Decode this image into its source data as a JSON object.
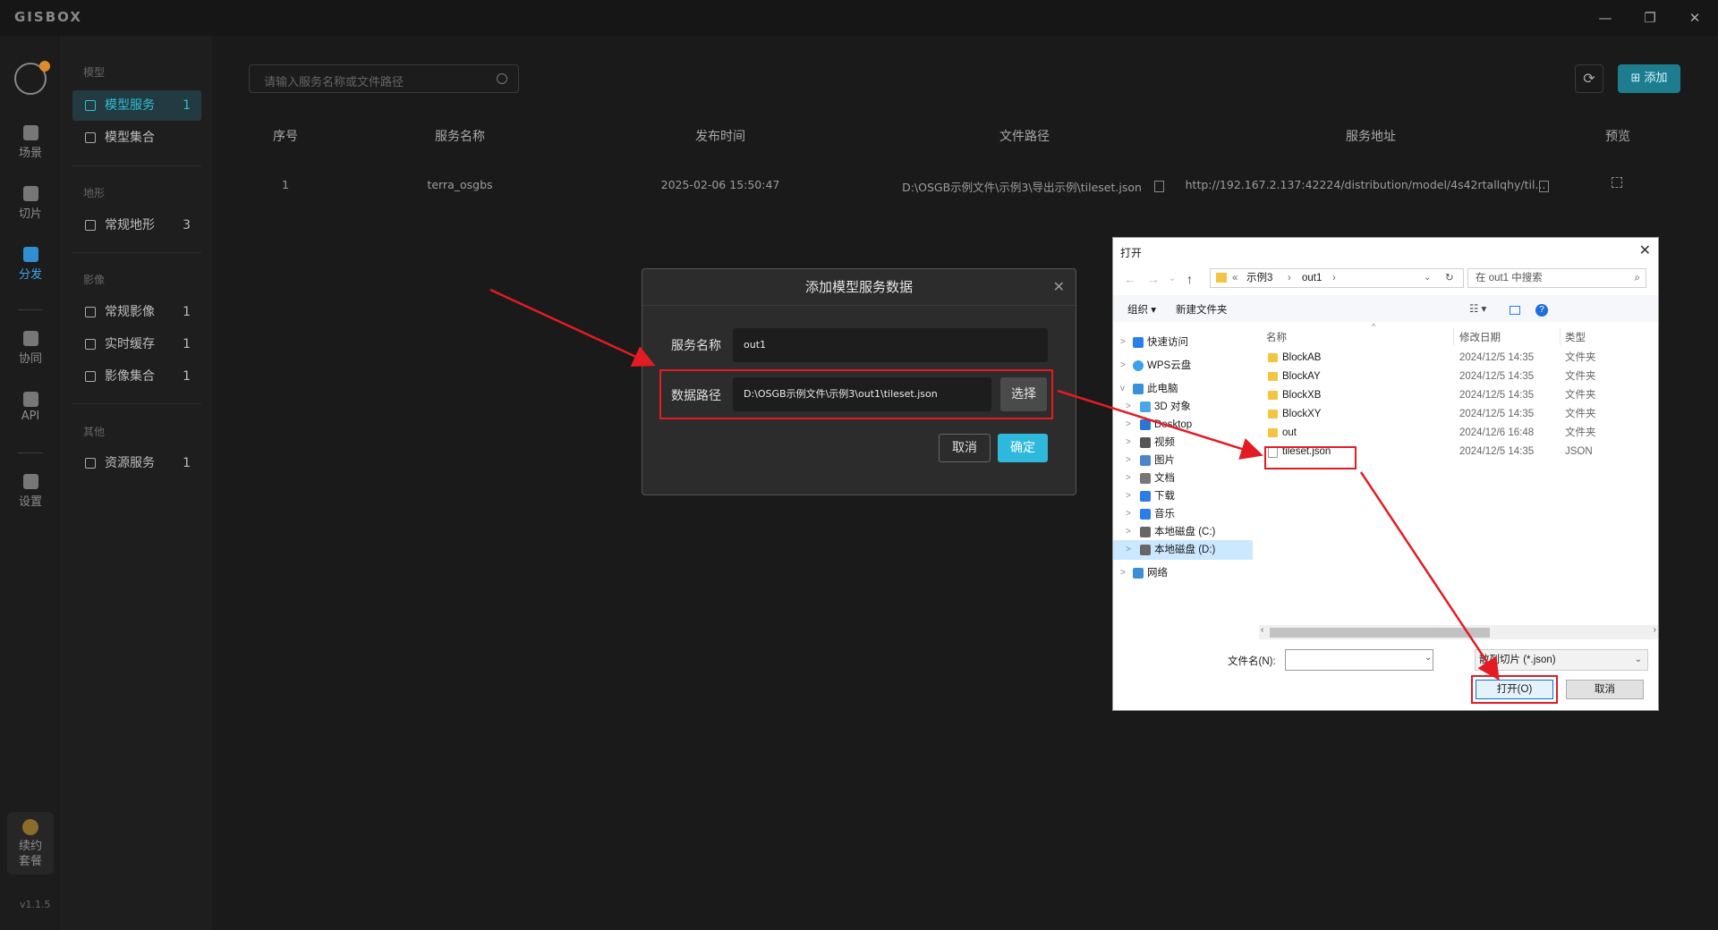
{
  "app": {
    "logo": "GISBOX",
    "version": "v1.1.5"
  },
  "window_controls": {
    "minimize": "—",
    "maximize": "❐",
    "close": "✕"
  },
  "rail": {
    "items": [
      {
        "label": "场景",
        "icon": "scene-icon"
      },
      {
        "label": "切片",
        "icon": "slice-icon"
      },
      {
        "label": "分发",
        "icon": "distribute-icon",
        "active": true
      },
      {
        "label": "协同",
        "icon": "collab-icon"
      },
      {
        "label": "API",
        "icon": "api-icon"
      },
      {
        "label": "设置",
        "icon": "settings-icon"
      }
    ],
    "renew_label_1": "续约",
    "renew_label_2": "套餐"
  },
  "sidebar": {
    "groups": [
      {
        "title": "模型",
        "items": [
          {
            "label": "模型服务",
            "count": "1",
            "active": true
          },
          {
            "label": "模型集合",
            "count": ""
          }
        ]
      },
      {
        "title": "地形",
        "items": [
          {
            "label": "常规地形",
            "count": "3"
          }
        ]
      },
      {
        "title": "影像",
        "items": [
          {
            "label": "常规影像",
            "count": "1"
          },
          {
            "label": "实时缓存",
            "count": "1"
          },
          {
            "label": "影像集合",
            "count": "1"
          }
        ]
      },
      {
        "title": "其他",
        "items": [
          {
            "label": "资源服务",
            "count": "1"
          }
        ]
      }
    ]
  },
  "main": {
    "search_placeholder": "请输入服务名称或文件路径",
    "add_label": "添加",
    "columns": [
      "序号",
      "服务名称",
      "发布时间",
      "文件路径",
      "服务地址",
      "预览"
    ],
    "rows": [
      {
        "index": "1",
        "name": "terra_osgbs",
        "time": "2025-02-06 15:50:47",
        "path": "D:\\OSGB示例文件\\示例3\\导出示例\\tileset.json",
        "url": "http://192.167.2.137:42224/distribution/model/4s42rtallqhy/til..."
      }
    ]
  },
  "dialog": {
    "title": "添加模型服务数据",
    "name_label": "服务名称",
    "name_value": "out1",
    "path_label": "数据路径",
    "path_value": "D:\\OSGB示例文件\\示例3\\out1\\tileset.json",
    "choose_label": "选择",
    "cancel_label": "取消",
    "ok_label": "确定"
  },
  "file_dialog": {
    "title": "打开",
    "breadcrumb": [
      "«",
      "示例3",
      "›",
      "out1",
      "›"
    ],
    "search_placeholder": "在 out1 中搜索",
    "organize": "组织 ▾",
    "new_folder": "新建文件夹",
    "columns": {
      "name": "名称",
      "date": "修改日期",
      "type": "类型"
    },
    "tree": [
      {
        "label": "快速访问",
        "color": "#2b7de9",
        "indent": 0,
        "chevron": ">"
      },
      {
        "label": "WPS云盘",
        "color": "#3aa0f0",
        "indent": 0,
        "chevron": ">"
      },
      {
        "label": "此电脑",
        "color": "#3b8fd8",
        "indent": 0,
        "chevron": "v"
      },
      {
        "label": "3D 对象",
        "color": "#4aa6e8",
        "indent": 1,
        "chevron": ">"
      },
      {
        "label": "Desktop",
        "color": "#2a76d2",
        "indent": 1,
        "chevron": ">"
      },
      {
        "label": "视频",
        "color": "#555",
        "indent": 1,
        "chevron": ">"
      },
      {
        "label": "图片",
        "color": "#4a86c8",
        "indent": 1,
        "chevron": ">"
      },
      {
        "label": "文档",
        "color": "#777",
        "indent": 1,
        "chevron": ">"
      },
      {
        "label": "下载",
        "color": "#2b7de9",
        "indent": 1,
        "chevron": ">"
      },
      {
        "label": "音乐",
        "color": "#2b7de9",
        "indent": 1,
        "chevron": ">"
      },
      {
        "label": "本地磁盘 (C:)",
        "color": "#666",
        "indent": 1,
        "chevron": ">"
      },
      {
        "label": "本地磁盘 (D:)",
        "color": "#666",
        "indent": 1,
        "chevron": ">",
        "selected": true
      },
      {
        "label": "网络",
        "color": "#3a8fd8",
        "indent": 0,
        "chevron": ">"
      }
    ],
    "files": [
      {
        "name": "BlockAB",
        "date": "2024/12/5 14:35",
        "type": "文件夹",
        "kind": "folder"
      },
      {
        "name": "BlockAY",
        "date": "2024/12/5 14:35",
        "type": "文件夹",
        "kind": "folder"
      },
      {
        "name": "BlockXB",
        "date": "2024/12/5 14:35",
        "type": "文件夹",
        "kind": "folder"
      },
      {
        "name": "BlockXY",
        "date": "2024/12/5 14:35",
        "type": "文件夹",
        "kind": "folder"
      },
      {
        "name": "out",
        "date": "2024/12/6 16:48",
        "type": "文件夹",
        "kind": "folder"
      },
      {
        "name": "tileset.json",
        "date": "2024/12/5 14:35",
        "type": "JSON",
        "kind": "file"
      }
    ],
    "filename_label": "文件名(N):",
    "filename_value": "",
    "filter_value": "散列切片 (*.json)",
    "open_label": "打开(O)",
    "cancel_label": "取消"
  },
  "colors": {
    "accent": "#2fbfd4",
    "highlight": "#e31b23",
    "ok_button": "#2eb8dc"
  }
}
